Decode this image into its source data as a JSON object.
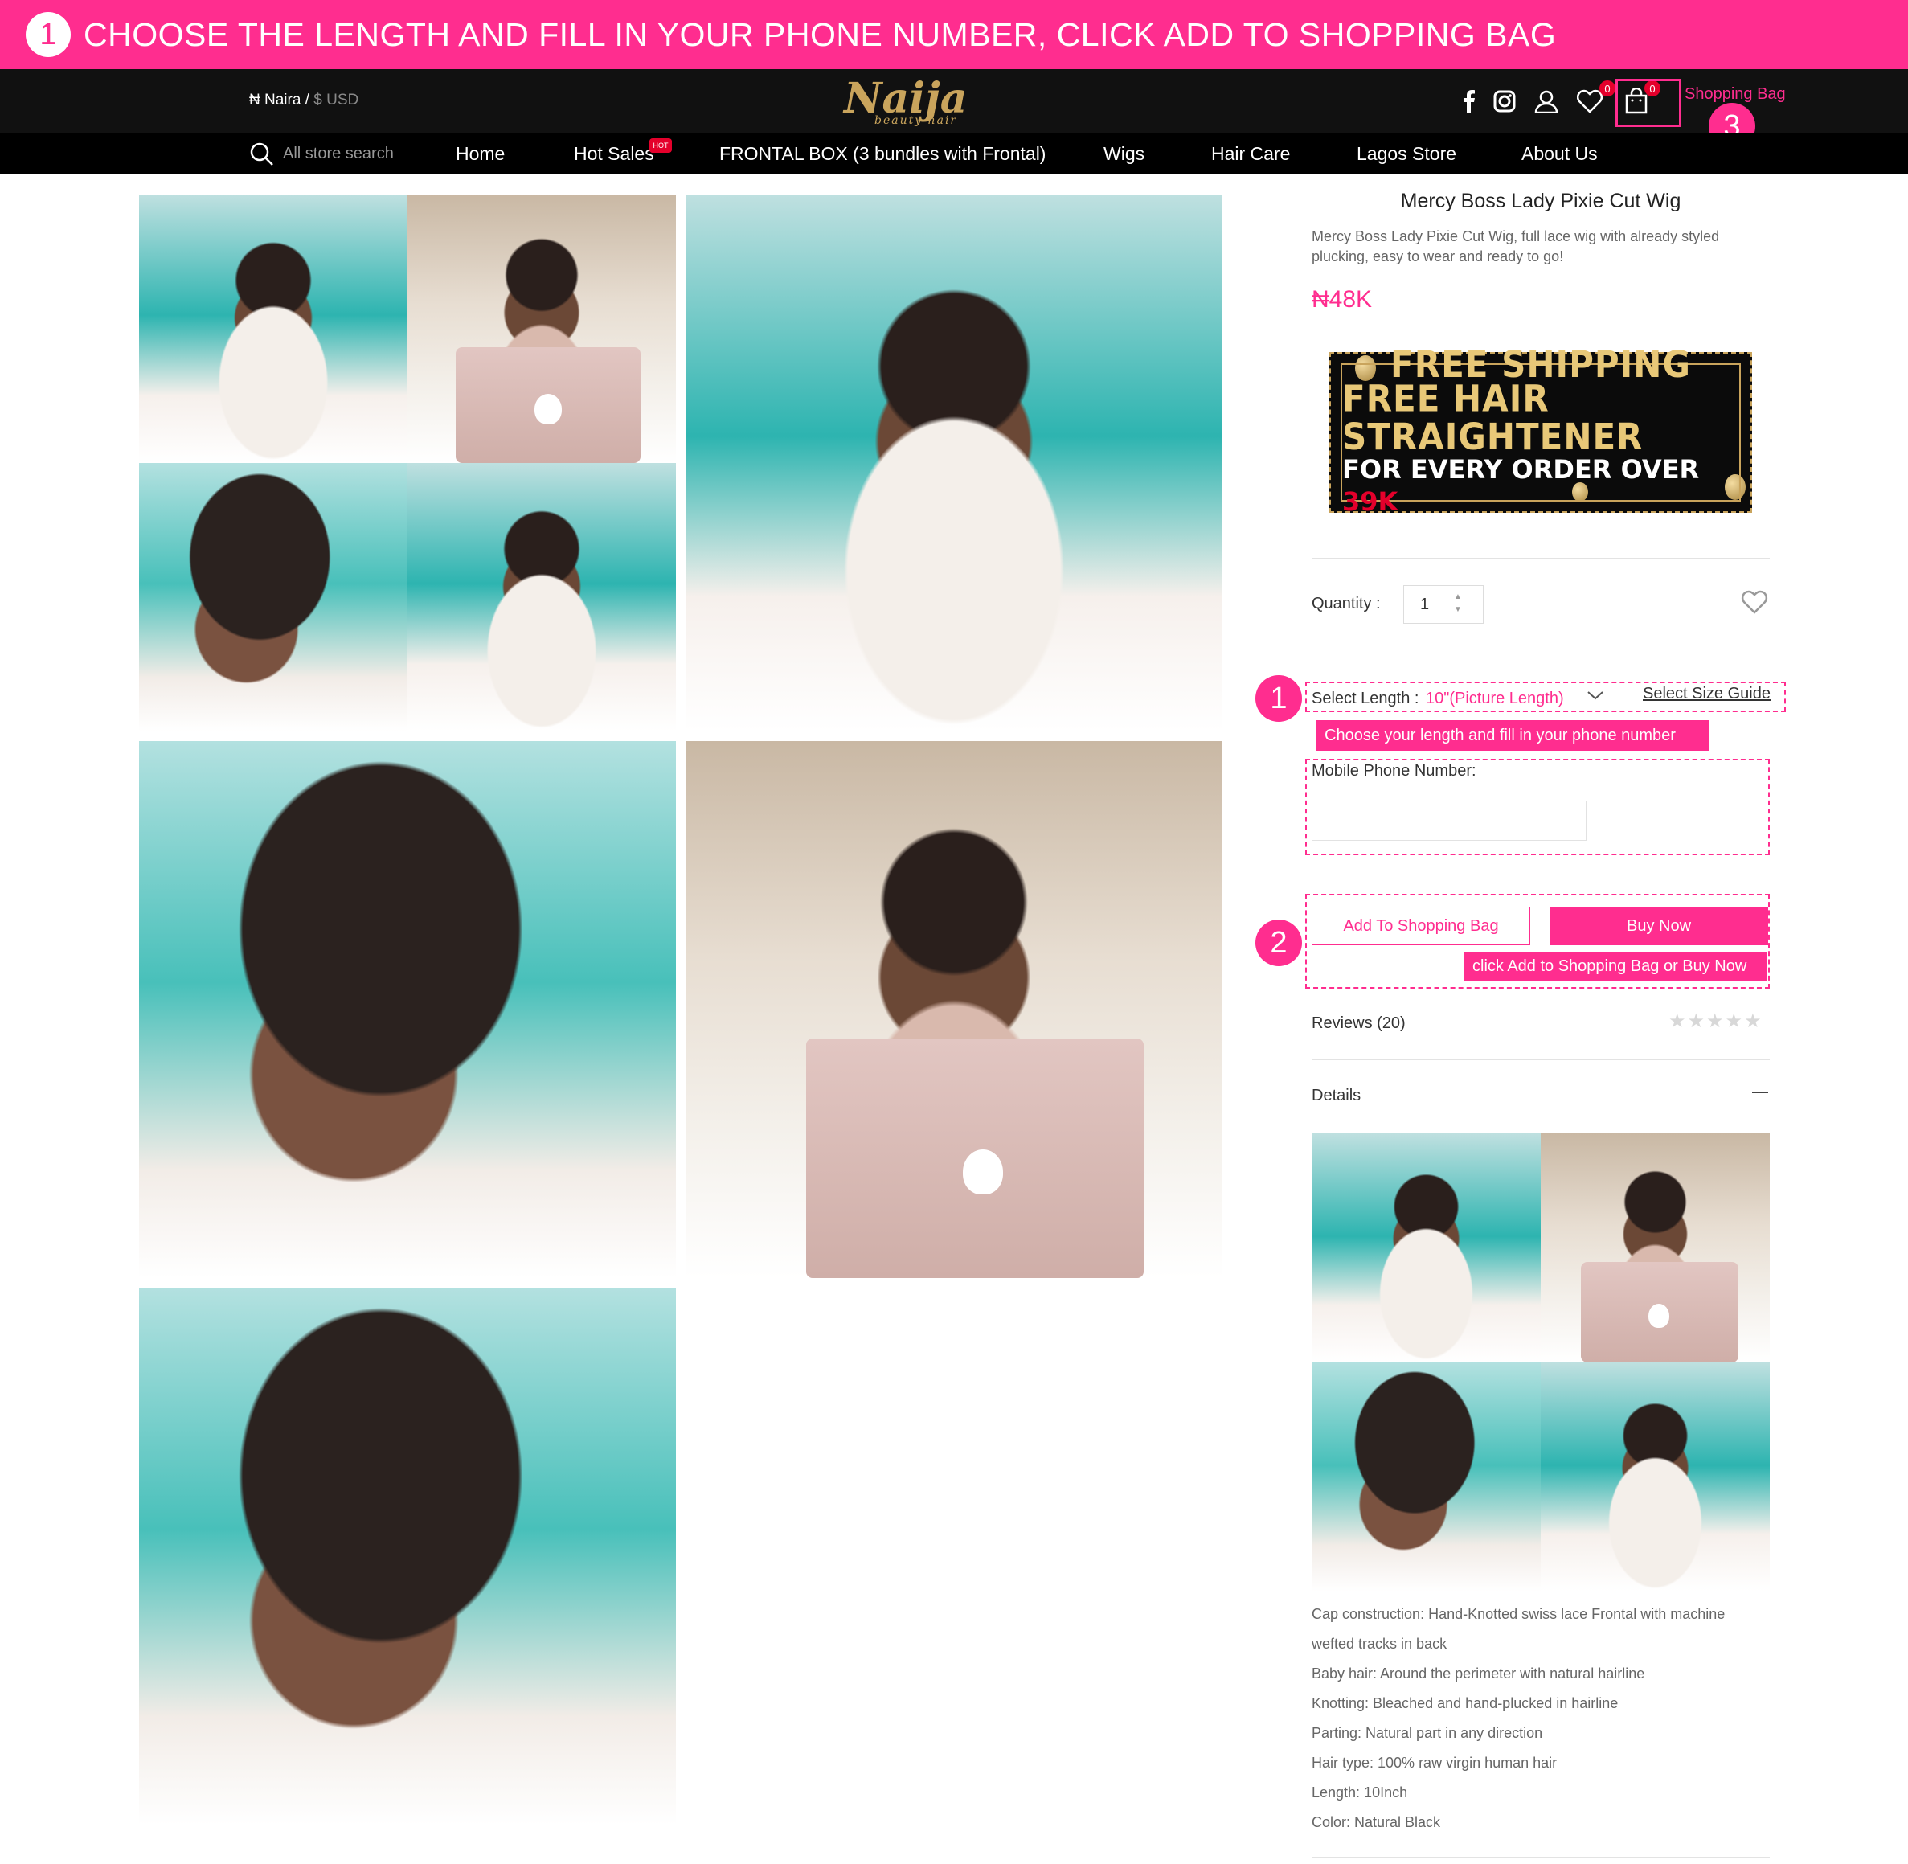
{
  "banner": {
    "step": "1",
    "text": "CHOOSE THE LENGTH AND FILL IN YOUR PHONE NUMBER, CLICK ADD TO SHOPPING BAG"
  },
  "header": {
    "currency_naira": "₦ Naira /",
    "currency_usd": "$ USD",
    "logo_main": "Naija",
    "logo_sub": "beauty hair",
    "wishlist_count": "0",
    "cart_count": "0",
    "bag_label": "Shopping Bag",
    "bag_step": "3"
  },
  "nav": {
    "search_placeholder": "All store search",
    "items": [
      "Home",
      "Hot Sales",
      "FRONTAL BOX (3 bundles with Frontal)",
      "Wigs",
      "Hair Care",
      "Lagos Store",
      "About Us"
    ],
    "hot_tag": "HOT"
  },
  "product": {
    "title": "Mercy Boss Lady Pixie Cut Wig",
    "description": "Mercy Boss Lady Pixie Cut Wig, full lace wig with already styled plucking, easy to wear and ready to go!",
    "price": "₦48K",
    "promo": {
      "line1": "FREE SHIPPING",
      "line2": "FREE HAIR STRAIGHTENER",
      "line3": "FOR EVERY ORDER OVER",
      "line3_highlight": "39K"
    },
    "quantity_label": "Quantity :",
    "quantity": "1",
    "select_label": "Select Length :",
    "select_value": "10\"(Picture Length)",
    "size_guide": "Select Size Guide",
    "step1": "1",
    "note1": "Choose your length and fill in your phone number",
    "phone_label": "Mobile Phone Number:",
    "phone_value": "",
    "add_button": "Add To Shopping Bag",
    "buy_button": "Buy Now",
    "step2": "2",
    "note2": "click Add to Shopping Bag or Buy Now",
    "reviews": "Reviews (20)",
    "stars": "★★★★★",
    "rating": 0,
    "details": "Details",
    "specs": [
      "Cap construction: Hand-Knotted swiss lace Frontal with machine",
      "wefted tracks in back",
      "Baby hair: Around the perimeter with natural hairline",
      "Knotting: Bleached and hand-plucked in hairline",
      "Parting: Natural part in any direction",
      "Hair type: 100% raw virgin human hair",
      "Length: 10Inch",
      "Color: Natural Black"
    ]
  },
  "colors": {
    "accent": "#ff2d8f",
    "header_bg": "#111111",
    "nav_bg": "#000000",
    "gold": "#c9a45c"
  }
}
